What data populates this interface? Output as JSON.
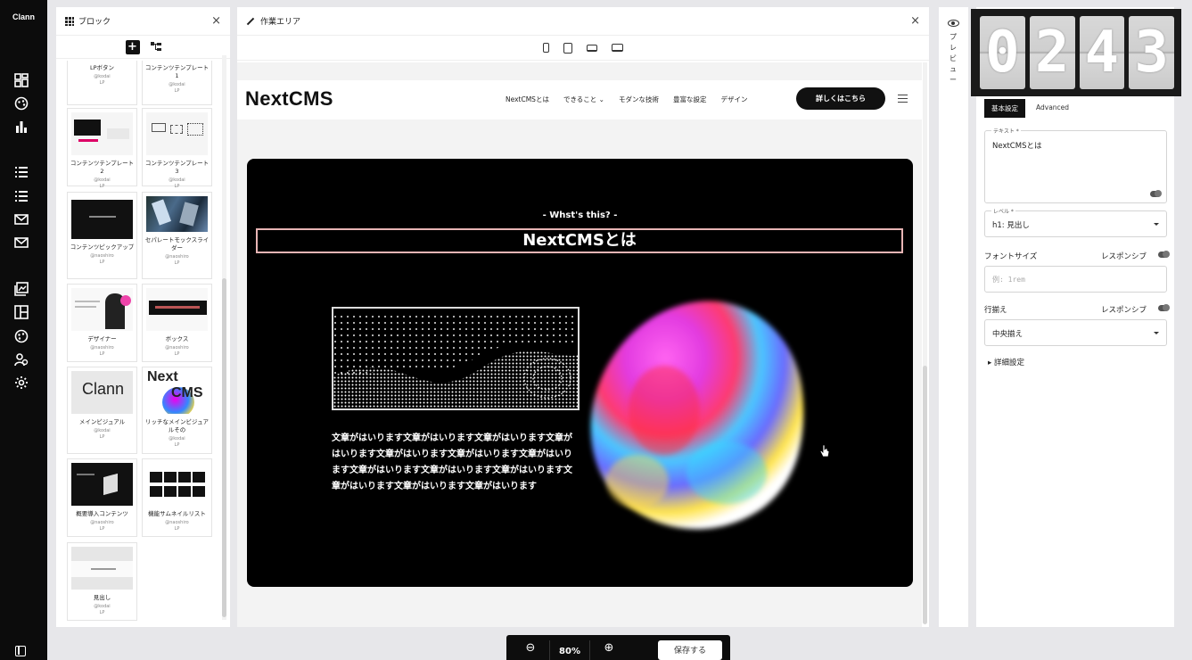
{
  "app": {
    "logo": "Clann"
  },
  "rail": {
    "icons": [
      "dashboard-icon",
      "palette-icon",
      "chart-icon",
      "list-icon",
      "list-icon",
      "mail-icon",
      "mail-icon",
      "gallery-icon",
      "layout-icon",
      "palette-icon",
      "users-icon",
      "gear-icon",
      "sidebar-toggle-icon"
    ]
  },
  "blocks_panel": {
    "title": "ブロック",
    "close": "×",
    "add": "+",
    "cards": [
      {
        "name": "LPボタン",
        "author": "@kodai",
        "tag": "LP"
      },
      {
        "name": "コンテンツテンプレート1",
        "author": "@kodai",
        "tag": "LP"
      },
      {
        "name": "コンテンツテンプレート2",
        "author": "@kodai",
        "tag": "LP"
      },
      {
        "name": "コンテンツテンプレート3",
        "author": "@kodai",
        "tag": "LP"
      },
      {
        "name": "コンテンツピックアップ",
        "author": "@naoshiro",
        "tag": "LP"
      },
      {
        "name": "セパレートモックスライダー",
        "author": "@naoshiro",
        "tag": "LP"
      },
      {
        "name": "デザイナー",
        "author": "@naoshiro",
        "tag": "LP"
      },
      {
        "name": "ボックス",
        "author": "@naoshiro",
        "tag": "LP"
      },
      {
        "name": "メインビジュアル",
        "author": "@kodai",
        "tag": "LP"
      },
      {
        "name": "リッチなメインビジュアルその",
        "author": "@kodai",
        "tag": "LP"
      },
      {
        "name": "概要導入コンテンツ",
        "author": "@naoshiro",
        "tag": "LP"
      },
      {
        "name": "機能サムネイルリスト",
        "author": "@naoshiro",
        "tag": "LP"
      },
      {
        "name": "見出し",
        "author": "@kodai",
        "tag": "LP"
      }
    ],
    "thumb_texts": {
      "clann": "Clann",
      "next": "Next",
      "cms": "CMS"
    }
  },
  "work_area": {
    "title": "作業エリア",
    "close": "×",
    "site": {
      "logo": "NextCMS",
      "nav": [
        "NextCMSとは",
        "できること ⌄",
        "モダンな技術",
        "豊富な設定",
        "デザイン"
      ],
      "cta": "詳しくはこちら",
      "eyebrow": "- Whst's this? -",
      "heading": "NextCMSとは",
      "body": "文章がはいります文章がはいります文章がはいります文章がはいります文章がはいります文章がはいります文章がはいります文章がはいります文章がはいります文章がはいります文章がはいります文章がはいります文章がはいります"
    }
  },
  "preview": {
    "label": "プレビュー"
  },
  "settings": {
    "tabs": {
      "basic": "基本設定",
      "advanced": "Advanced"
    },
    "text_field": {
      "label": "テキスト *",
      "value": "NextCMSとは"
    },
    "level_field": {
      "label": "レベル *",
      "value": "h1: 見出し"
    },
    "font_size": {
      "label": "フォントサイズ",
      "responsive": "レスポンシブ",
      "placeholder": "例: 1rem"
    },
    "align": {
      "label": "行揃え",
      "responsive": "レスポンシブ",
      "value": "中央揃え"
    },
    "detail": "▸  詳細設定"
  },
  "clock": {
    "digits": [
      "0",
      "2",
      "4",
      "3"
    ]
  },
  "bottom_bar": {
    "zoom_out": "⊖",
    "zoom": "80%",
    "zoom_in": "⊕",
    "save": "保存する"
  },
  "colors": {
    "accent": "#111111",
    "hero_border": "#e8b5b5"
  }
}
